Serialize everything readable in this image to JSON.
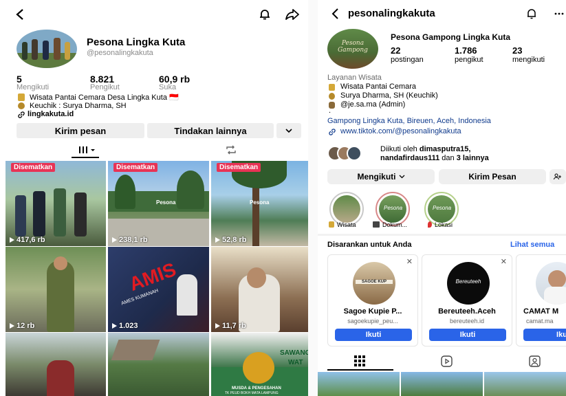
{
  "tiktok": {
    "display_name": "Pesona Lingka Kuta",
    "username": "@pesonalingkakuta",
    "stats": [
      {
        "value": "5",
        "label": "Mengikuti"
      },
      {
        "value": "8.821",
        "label": "Pengikut"
      },
      {
        "value": "60,9 rb",
        "label": "Suka"
      }
    ],
    "bio_line1": "Wisata Pantai Cemara Desa Lingka Kuta 🇮🇩",
    "bio_line2": "Keuchik : Surya Dharma, SH",
    "website": "lingkakuta.id",
    "message_button": "Kirim pesan",
    "more_button": "Tindakan lainnya",
    "tiles": [
      {
        "pinned": "Disematkan",
        "views": "417,6 rb"
      },
      {
        "pinned": "Disematkan",
        "views": "238,1 rb"
      },
      {
        "pinned": "Disematkan",
        "views": "52,8 rb"
      },
      {
        "pinned": "",
        "views": "12 rb"
      },
      {
        "pinned": "",
        "views": "1.023"
      },
      {
        "pinned": "",
        "views": "11,7 rb"
      },
      {
        "pinned": "",
        "views": ""
      },
      {
        "pinned": "",
        "views": ""
      },
      {
        "pinned": "",
        "views": ""
      }
    ],
    "tile_texts": {
      "logo": "Pesona",
      "amis": "AMIS",
      "amis_sub": "AMES KUMANAH",
      "banner1": "MUSDA & PENGESAHAN",
      "banner2": "TK PEUD BOKH MATA LAMPUNG",
      "sawang": "SAWANG",
      "wat": "WAT"
    }
  },
  "instagram": {
    "username": "pesonalingkakuta",
    "full_name": "Pesona Gampong Lingka Kuta",
    "avatar_text": "Pesona Gampong",
    "stats": [
      {
        "value": "22",
        "label": "postingan"
      },
      {
        "value": "1.786",
        "label": "pengikut"
      },
      {
        "value": "23",
        "label": "mengikuti"
      }
    ],
    "category": "Layanan Wisata",
    "bio": [
      "Wisata Pantai Cemara",
      "Surya Dharma, SH (Keuchik)",
      "@je.sa.ma (Admin)"
    ],
    "dot": ".",
    "location": "Gampong Lingka Kuta, Bireuen, Aceh, Indonesia",
    "link": "www.tiktok.com/@pesonalingkakuta",
    "followed_by_prefix": "Diikuti oleh ",
    "followed_by_names": "dimasputra15,",
    "followed_by_line2_names": "nandafirdaus111",
    "followed_by_line2_mid": " dan ",
    "followed_by_line2_end": "3 lainnya",
    "following_button": "Mengikuti",
    "message_button": "Kirim Pesan",
    "highlights": [
      {
        "label": "Wisata",
        "inner_text": ""
      },
      {
        "label": "Dokum...",
        "inner_text": "Pesona"
      },
      {
        "label": "Lokasi",
        "inner_text": "Pesona"
      }
    ],
    "suggested_title": "Disarankan untuk Anda",
    "see_all": "Lihat semua",
    "suggestions": [
      {
        "name": "Sagoe Kupie P...",
        "handle": "sagoekupie_peu...",
        "avatar_text": "SAGOE KUP",
        "follow": "Ikuti"
      },
      {
        "name": "Bereuteeh.Aceh",
        "handle": "bereuteeh.id",
        "avatar_text": "Bereuteeh",
        "follow": "Ikuti"
      },
      {
        "name": "CAMAT M",
        "handle": "camat.ma",
        "avatar_text": "",
        "follow": "Iku"
      }
    ]
  }
}
